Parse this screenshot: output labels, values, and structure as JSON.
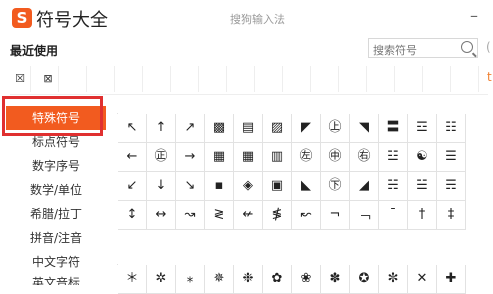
{
  "titlebar": {
    "logo": "S",
    "title": "符号大全",
    "subtitle": "搜狗输入法",
    "minimize": "–"
  },
  "recent": {
    "label": "最近使用",
    "symbols": [
      "☒",
      "⊠"
    ]
  },
  "search": {
    "placeholder": "搜索符号"
  },
  "edge": {
    "mark1": "(",
    "mark2": "t"
  },
  "sidebar": {
    "items": [
      {
        "label": "特殊符号",
        "active": true
      },
      {
        "label": "标点符号",
        "active": false
      },
      {
        "label": "数字序号",
        "active": false
      },
      {
        "label": "数学/单位",
        "active": false
      },
      {
        "label": "希腊/拉丁",
        "active": false
      },
      {
        "label": "拼音/注音",
        "active": false
      },
      {
        "label": "中文字符",
        "active": false
      },
      {
        "label": "英文音标",
        "active": false
      }
    ]
  },
  "symbols": {
    "rows": [
      [
        "↖",
        "↑",
        "↗",
        "▩",
        "▤",
        "▨",
        "◤",
        "㊤",
        "◥",
        "〓",
        "☲",
        "☷"
      ],
      [
        "←",
        "㊣",
        "→",
        "▦",
        "▦",
        "▥",
        "㊧",
        "㊥",
        "㊨",
        "☳",
        "☯",
        "☰"
      ],
      [
        "↙",
        "↓",
        "↘",
        "▪",
        "◈",
        "▣",
        "◣",
        "㊦",
        "◢",
        "☵",
        "☱",
        "☴"
      ],
      [
        "↕",
        "↔",
        "↝",
        "≷",
        "↚",
        "≸",
        "↜",
        "¬",
        "﹁",
        "¯",
        "†",
        "‡"
      ]
    ],
    "bottom_row": [
      "＊",
      "✲",
      "⁎",
      "✵",
      "❉",
      "✿",
      "❀",
      "✽",
      "✪",
      "✼",
      "✕",
      "✚"
    ]
  }
}
